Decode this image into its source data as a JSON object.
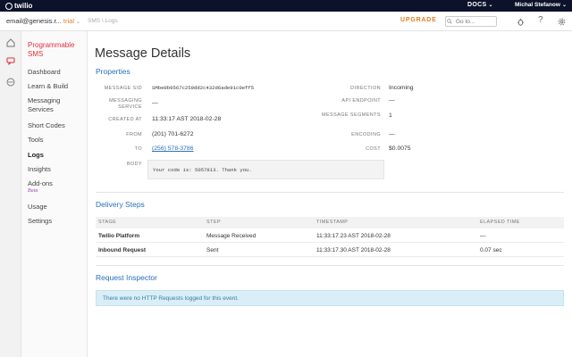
{
  "topbar": {
    "logo_text": "twilio",
    "docs_label": "DOCS",
    "user_name": "Michal Stefanow"
  },
  "secbar": {
    "account_email": "email@genesis.r...",
    "account_type": "trial",
    "breadcrumbs": [
      "SMS",
      "Logs"
    ],
    "upgrade_label": "UPGRADE",
    "search_placeholder": "Go to..."
  },
  "nav": {
    "product_title": "Programmable SMS",
    "items": [
      {
        "label": "Dashboard"
      },
      {
        "label": "Learn & Build"
      },
      {
        "label": "Messaging Services"
      },
      {
        "label": "Short Codes"
      },
      {
        "label": "Tools"
      },
      {
        "label": "Logs",
        "active": true
      },
      {
        "label": "Insights"
      },
      {
        "label": "Add-ons",
        "badge": "Beta"
      },
      {
        "label": "Usage"
      },
      {
        "label": "Settings"
      }
    ]
  },
  "page": {
    "title": "Message Details",
    "properties_heading": "Properties",
    "left_fields": [
      {
        "label": "MESSAGE SID",
        "value": "SMbe0b9567c259dd2c432d6ade91c0eff5"
      },
      {
        "label": "MESSAGING SERVICE",
        "value": "—"
      },
      {
        "label": "CREATED AT",
        "value": "11:33:17 AST 2018-02-28"
      },
      {
        "label": "FROM",
        "value": "(201) 701-6272"
      },
      {
        "label": "TO",
        "value": "(256) 578-3786"
      },
      {
        "label": "BODY",
        "value": "Your code is: 5057813. Thank you."
      }
    ],
    "right_fields": [
      {
        "label": "DIRECTION",
        "value": "Incoming"
      },
      {
        "label": "API ENDPOINT",
        "value": "—"
      },
      {
        "label": "MESSAGE SEGMENTS",
        "value": "1"
      },
      {
        "label": "ENCODING",
        "value": "—"
      },
      {
        "label": "COST",
        "value": "$0.0075"
      }
    ],
    "delivery_heading": "Delivery Steps",
    "delivery_columns": [
      "STAGE",
      "STEP",
      "TIMESTAMP",
      "ELAPSED TIME"
    ],
    "delivery_rows": [
      {
        "stage": "Twilio Platform",
        "step": "Message Received",
        "timestamp": "11:33:17.23 AST 2018-02-28",
        "elapsed": "—"
      },
      {
        "stage": "Inbound Request",
        "step": "Sent",
        "timestamp": "11:33:17.30 AST 2018-02-28",
        "elapsed": "0.07 sec"
      }
    ],
    "request_heading": "Request Inspector",
    "request_message": "There were no HTTP Requests logged for this event."
  },
  "colors": {
    "accent_red": "#e0313f",
    "link_blue": "#2a6ebb",
    "upgrade_orange": "#e07d26",
    "topbar_bg": "#0d122b"
  }
}
